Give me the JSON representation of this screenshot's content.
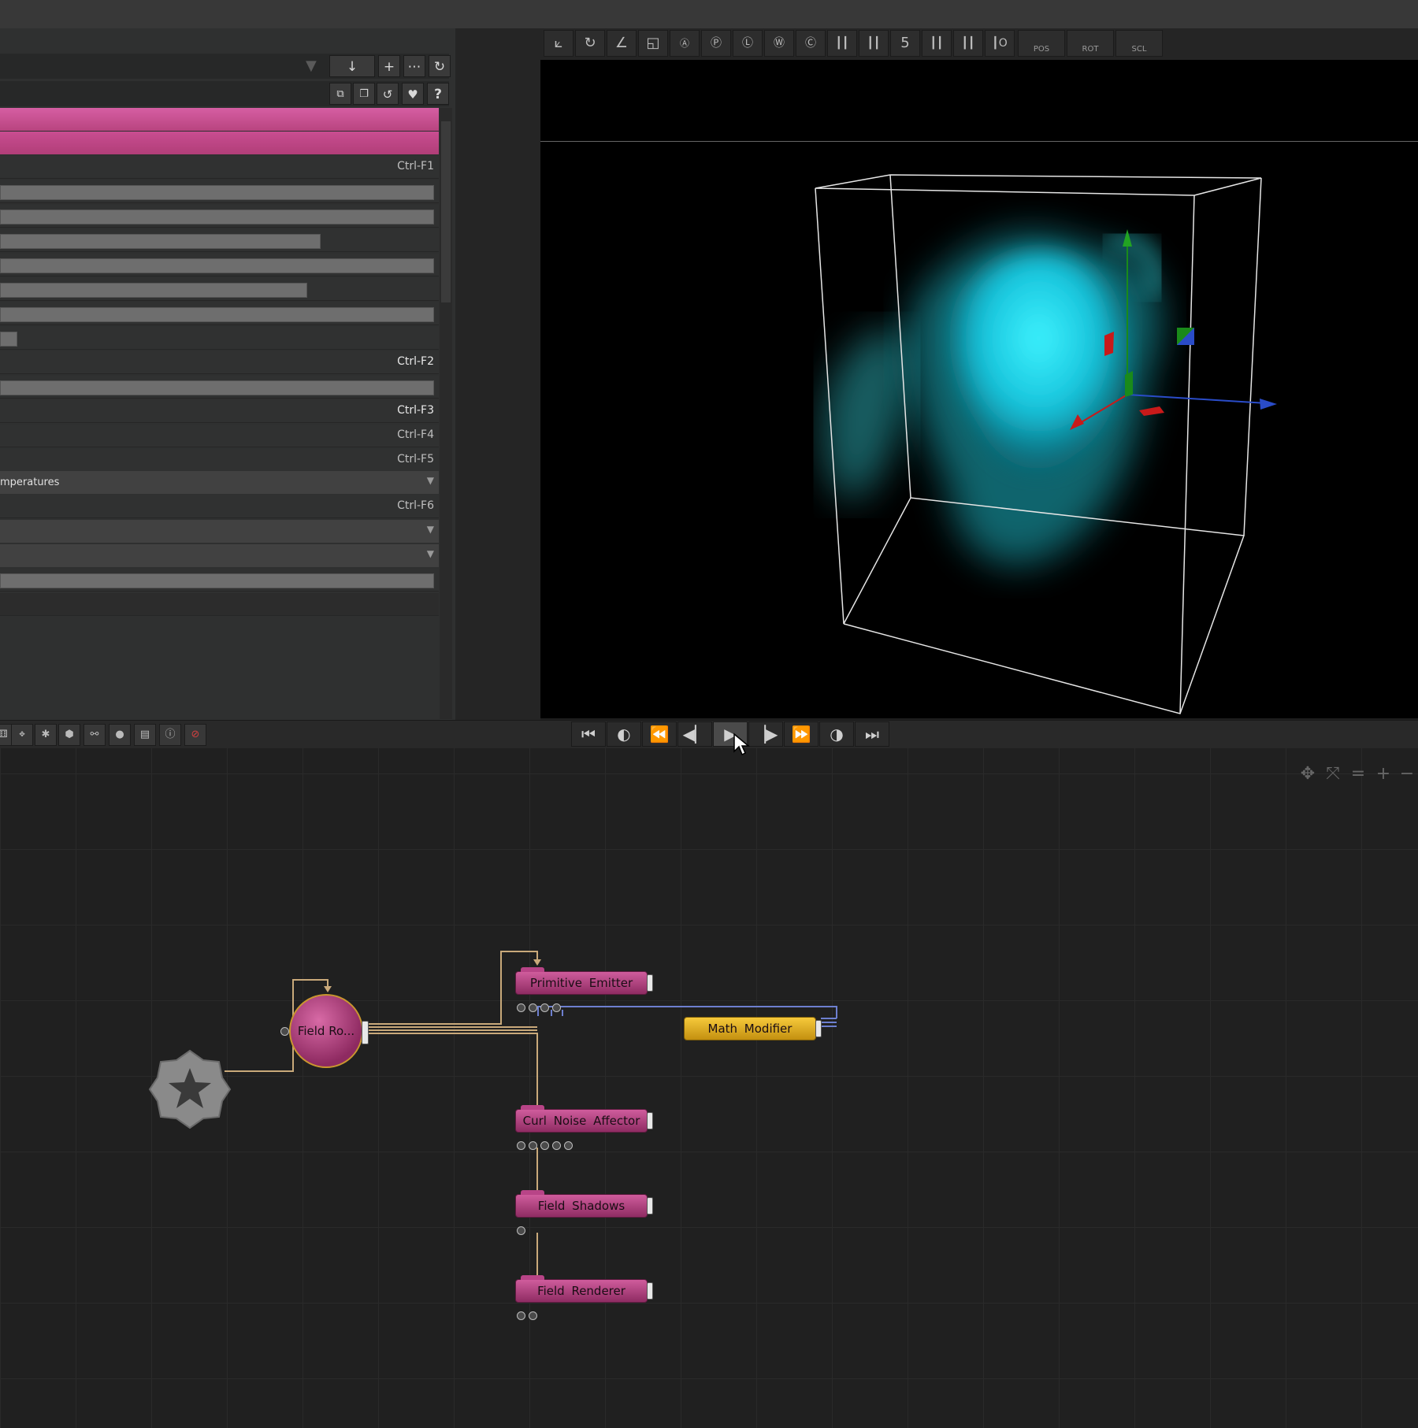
{
  "left_panel": {
    "shortcuts": [
      "Ctrl-F1",
      "Ctrl-F2",
      "Ctrl-F3",
      "Ctrl-F4",
      "Ctrl-F5",
      "Ctrl-F6"
    ],
    "dropdown_value": "mperatures",
    "sliders": [
      0.99,
      0.99,
      0.73,
      0.99,
      0.7,
      0.99,
      0.04,
      0.99,
      0.99
    ]
  },
  "viewport": {
    "toolbar_number": "5",
    "lock_labels": [
      "POS",
      "ROT",
      "SCL"
    ]
  },
  "graph": {
    "nodes": {
      "field_root": "Field Ro...",
      "primitive_emitter": "Primitive Emitter",
      "math_modifier": "Math Modifier",
      "curl_noise_affector": "Curl Noise Affector",
      "field_shadows": "Field Shadows",
      "field_renderer": "Field Renderer"
    }
  },
  "colors": {
    "node_pink": "#c14b8a",
    "node_yellow": "#e8b223",
    "wire_tan": "#c9a97a",
    "wire_blue": "#6d7fcf",
    "smoke_cyan": "#20e0ff"
  }
}
